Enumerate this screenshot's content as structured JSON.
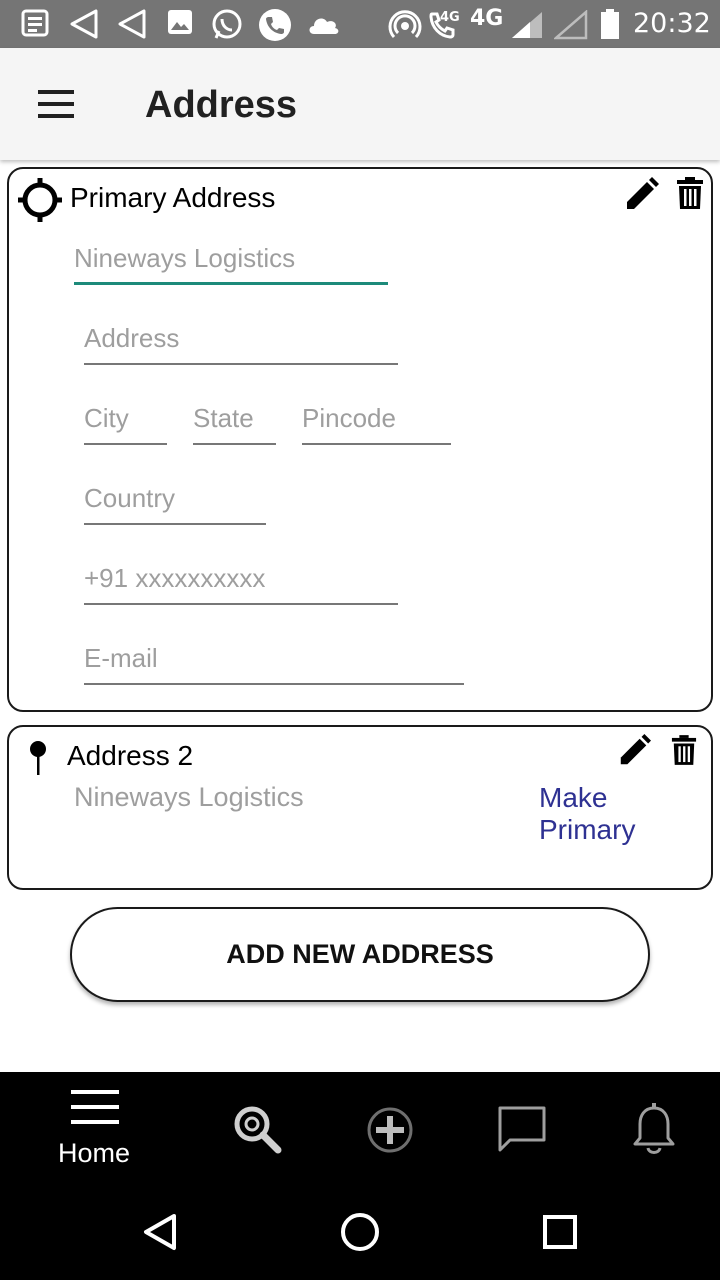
{
  "status_bar": {
    "network_label": "4G",
    "network_small": "4G",
    "time": "20:32"
  },
  "header": {
    "title": "Address",
    "menu_icon": "hamburger-menu-icon"
  },
  "primary_card": {
    "title": "Primary Address",
    "icon": "location-target-icon",
    "fields": {
      "name_placeholder": "Nineways Logistics",
      "address_placeholder": "Address",
      "city_placeholder": "City",
      "state_placeholder": "State",
      "pincode_placeholder": "Pincode",
      "country_placeholder": "Country",
      "phone_placeholder": "+91 xxxxxxxxxx",
      "email_placeholder": "E-mail"
    }
  },
  "secondary_card": {
    "title": "Address 2",
    "name": "Nineways Logistics",
    "make_primary_label": "Make Primary",
    "icon": "pin-icon"
  },
  "add_button_label": "ADD NEW ADDRESS",
  "bottom_nav": {
    "home_label": "Home",
    "items": [
      "home",
      "search",
      "add",
      "chat",
      "notifications"
    ]
  },
  "colors": {
    "accent": "#1d8a7a",
    "link": "#2e3192",
    "status_bar": "#757575",
    "app_bar": "#f5f5f5"
  }
}
